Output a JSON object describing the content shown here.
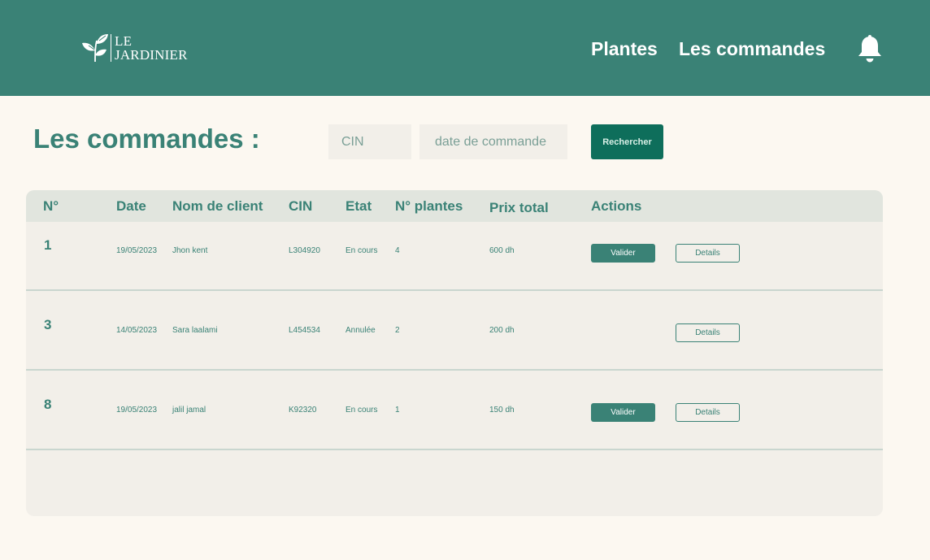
{
  "brand": {
    "line1": "LE",
    "line2": "JARDINIER",
    "accent": "#3a8276"
  },
  "nav": {
    "plantes": "Plantes",
    "commandes": "Les commandes",
    "bell_icon": "bell-icon"
  },
  "page": {
    "title": "Les commandes :"
  },
  "search": {
    "cin_placeholder": "CIN",
    "date_placeholder": "date de commande",
    "button_label": "Rechercher"
  },
  "table": {
    "headers": {
      "num": "N°",
      "date": "Date",
      "client": "Nom de client",
      "cin": "CIN",
      "etat": "Etat",
      "plantes": "N° plantes",
      "prix": "Prix total",
      "actions": "Actions"
    },
    "rows": [
      {
        "num": "1",
        "date": "19/05/2023",
        "client": "Jhon kent",
        "cin": "L304920",
        "etat": "En cours",
        "plantes": "4",
        "prix": "600 dh",
        "valider": "Valider",
        "details": "Details"
      },
      {
        "num": "3",
        "date": "14/05/2023",
        "client": "Sara laalami",
        "cin": "L454534",
        "etat": "Annulée",
        "plantes": "2",
        "prix": "200 dh",
        "details": "Details"
      },
      {
        "num": "8",
        "date": "19/05/2023",
        "client": "jalil jamal",
        "cin": "K92320",
        "etat": "En cours",
        "plantes": "1",
        "prix": "150 dh",
        "valider": "Valider",
        "details": "Details"
      }
    ]
  }
}
